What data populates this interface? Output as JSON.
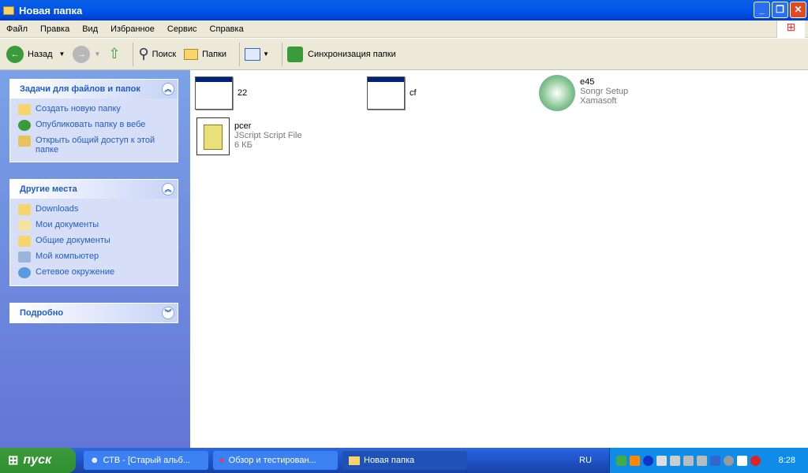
{
  "window": {
    "title": "Новая папка"
  },
  "menu": [
    "Файл",
    "Правка",
    "Вид",
    "Избранное",
    "Сервис",
    "Справка"
  ],
  "toolbar": {
    "back": "Назад",
    "search": "Поиск",
    "folders": "Папки",
    "sync": "Синхронизация папки"
  },
  "sidebar": {
    "tasks": {
      "title": "Задачи для файлов и папок",
      "items": [
        "Создать новую папку",
        "Опубликовать папку в вебе",
        "Открыть общий доступ к этой папке"
      ]
    },
    "places": {
      "title": "Другие места",
      "items": [
        "Downloads",
        "Мои документы",
        "Общие документы",
        "Мой компьютер",
        "Сетевое окружение"
      ]
    },
    "details": {
      "title": "Подробно"
    }
  },
  "files": [
    {
      "name": "22"
    },
    {
      "name": "cf"
    },
    {
      "name": "e45",
      "line2": "Songr Setup",
      "line3": "Xamasoft"
    },
    {
      "name": "pcer",
      "line2": "JScript Script File",
      "line3": "6 КБ"
    }
  ],
  "taskbar": {
    "start": "пуск",
    "tasks": [
      "СТВ - [Старый альб...",
      "Обзор и тестирован...",
      "Новая папка"
    ],
    "lang": "RU",
    "clock": "8:28"
  }
}
